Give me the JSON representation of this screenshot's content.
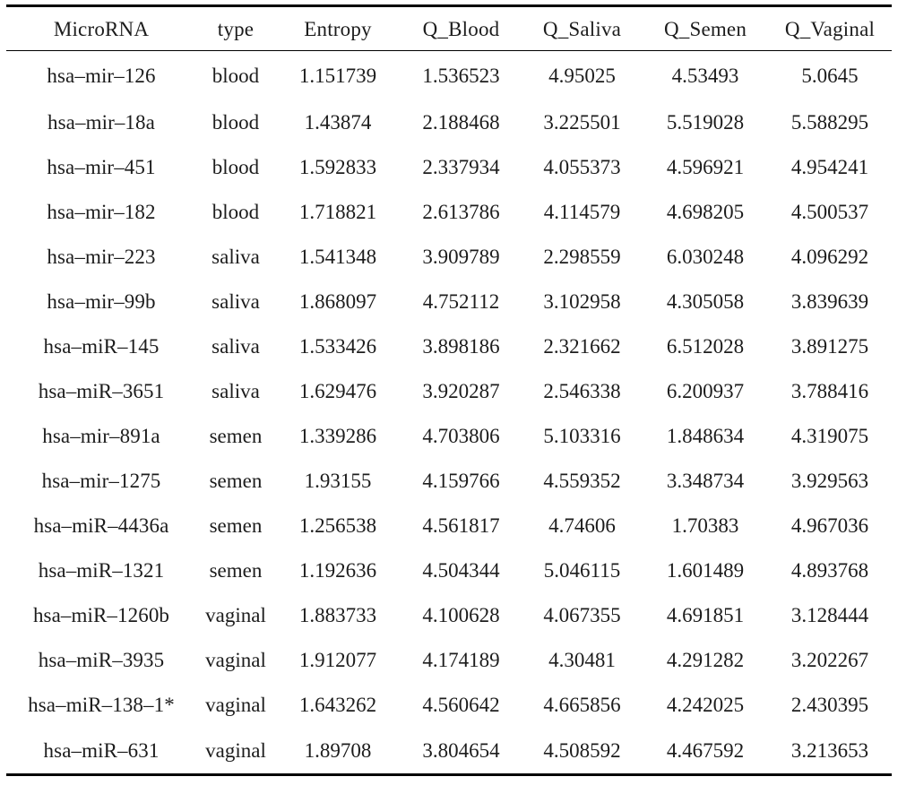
{
  "table": {
    "headers": [
      "MicroRNA",
      "type",
      "Entropy",
      "Q_Blood",
      "Q_Saliva",
      "Q_Semen",
      "Q_Vaginal"
    ],
    "rows": [
      {
        "microrna": "hsa–mir–126",
        "type": "blood",
        "entropy": "1.151739",
        "q_blood": "1.536523",
        "q_saliva": "4.95025",
        "q_semen": "4.53493",
        "q_vaginal": "5.0645",
        "bold_column": "q_blood"
      },
      {
        "microrna": "hsa–mir–18a",
        "type": "blood",
        "entropy": "1.43874",
        "q_blood": "2.188468",
        "q_saliva": "3.225501",
        "q_semen": "5.519028",
        "q_vaginal": "5.588295",
        "bold_column": "q_blood"
      },
      {
        "microrna": "hsa–mir–451",
        "type": "blood",
        "entropy": "1.592833",
        "q_blood": "2.337934",
        "q_saliva": "4.055373",
        "q_semen": "4.596921",
        "q_vaginal": "4.954241",
        "bold_column": "q_blood"
      },
      {
        "microrna": "hsa–mir–182",
        "type": "blood",
        "entropy": "1.718821",
        "q_blood": "2.613786",
        "q_saliva": "4.114579",
        "q_semen": "4.698205",
        "q_vaginal": "4.500537",
        "bold_column": "q_blood"
      },
      {
        "microrna": "hsa–mir–223",
        "type": "saliva",
        "entropy": "1.541348",
        "q_blood": "3.909789",
        "q_saliva": "2.298559",
        "q_semen": "6.030248",
        "q_vaginal": "4.096292",
        "bold_column": "q_saliva"
      },
      {
        "microrna": "hsa–mir–99b",
        "type": "saliva",
        "entropy": "1.868097",
        "q_blood": "4.752112",
        "q_saliva": "3.102958",
        "q_semen": "4.305058",
        "q_vaginal": "3.839639",
        "bold_column": "q_saliva"
      },
      {
        "microrna": "hsa–miR–145",
        "type": "saliva",
        "entropy": "1.533426",
        "q_blood": "3.898186",
        "q_saliva": "2.321662",
        "q_semen": "6.512028",
        "q_vaginal": "3.891275",
        "bold_column": "q_saliva"
      },
      {
        "microrna": "hsa–miR–3651",
        "type": "saliva",
        "entropy": "1.629476",
        "q_blood": "3.920287",
        "q_saliva": "2.546338",
        "q_semen": "6.200937",
        "q_vaginal": "3.788416",
        "bold_column": "q_saliva"
      },
      {
        "microrna": "hsa–mir–891a",
        "type": "semen",
        "entropy": "1.339286",
        "q_blood": "4.703806",
        "q_saliva": "5.103316",
        "q_semen": "1.848634",
        "q_vaginal": "4.319075",
        "bold_column": "q_semen"
      },
      {
        "microrna": "hsa–mir–1275",
        "type": "semen",
        "entropy": "1.93155",
        "q_blood": "4.159766",
        "q_saliva": "4.559352",
        "q_semen": "3.348734",
        "q_vaginal": "3.929563",
        "bold_column": "q_semen"
      },
      {
        "microrna": "hsa–miR–4436a",
        "type": "semen",
        "entropy": "1.256538",
        "q_blood": "4.561817",
        "q_saliva": "4.74606",
        "q_semen": "1.70383",
        "q_vaginal": "4.967036",
        "bold_column": "q_semen"
      },
      {
        "microrna": "hsa–miR–1321",
        "type": "semen",
        "entropy": "1.192636",
        "q_blood": "4.504344",
        "q_saliva": "5.046115",
        "q_semen": "1.601489",
        "q_vaginal": "4.893768",
        "bold_column": "q_semen"
      },
      {
        "microrna": "hsa–miR–1260b",
        "type": "vaginal",
        "entropy": "1.883733",
        "q_blood": "4.100628",
        "q_saliva": "4.067355",
        "q_semen": "4.691851",
        "q_vaginal": "3.128444",
        "bold_column": "q_vaginal"
      },
      {
        "microrna": "hsa–miR–3935",
        "type": "vaginal",
        "entropy": "1.912077",
        "q_blood": "4.174189",
        "q_saliva": "4.30481",
        "q_semen": "4.291282",
        "q_vaginal": "3.202267",
        "bold_column": "q_vaginal"
      },
      {
        "microrna": "hsa–miR–138–1*",
        "type": "vaginal",
        "entropy": "1.643262",
        "q_blood": "4.560642",
        "q_saliva": "4.665856",
        "q_semen": "4.242025",
        "q_vaginal": "2.430395",
        "bold_column": "q_vaginal"
      },
      {
        "microrna": "hsa–miR–631",
        "type": "vaginal",
        "entropy": "1.89708",
        "q_blood": "3.804654",
        "q_saliva": "4.508592",
        "q_semen": "4.467592",
        "q_vaginal": "3.213653",
        "bold_column": "q_vaginal"
      }
    ],
    "column_keys": [
      "microrna",
      "type",
      "entropy",
      "q_blood",
      "q_saliva",
      "q_semen",
      "q_vaginal"
    ],
    "rule_color": "#000000"
  }
}
